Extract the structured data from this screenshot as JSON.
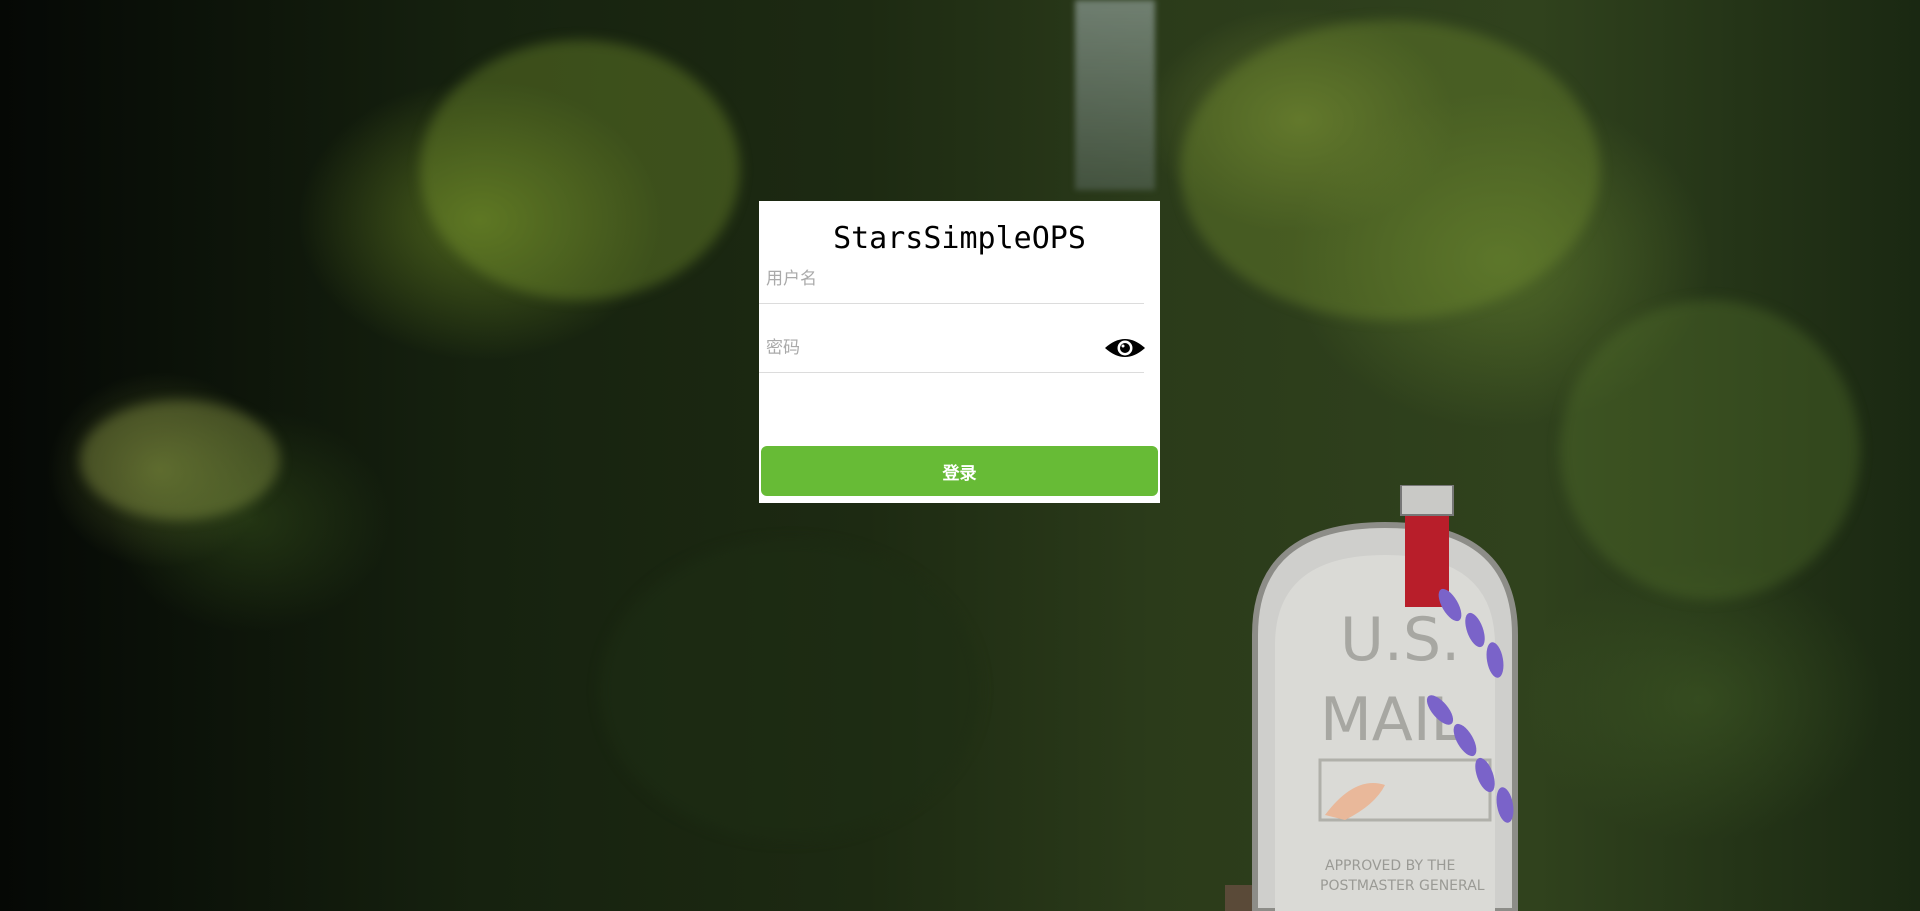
{
  "app": {
    "title": "StarsSimpleOPS"
  },
  "login_form": {
    "username": {
      "value": "",
      "placeholder": "用户名"
    },
    "password": {
      "value": "",
      "placeholder": "密码",
      "toggle_icon": "eye-icon"
    },
    "submit_label": "登录"
  },
  "colors": {
    "button": "#67bb36",
    "card": "#ffffff"
  }
}
